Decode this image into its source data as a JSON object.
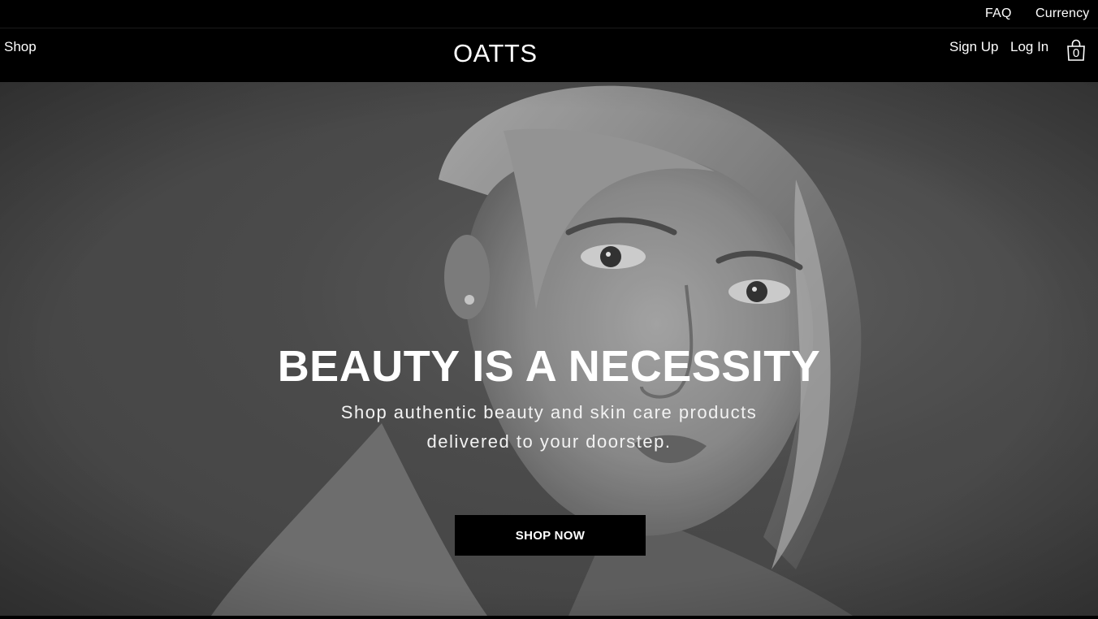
{
  "topbar": {
    "faq_label": "FAQ",
    "currency_label": "Currency"
  },
  "nav": {
    "shop_label": "Shop",
    "logo_text": "OATTS",
    "signup_label": "Sign Up",
    "login_label": "Log In",
    "cart_count": "0",
    "cart_icon": "shopping-bag-icon"
  },
  "hero": {
    "title": "BEAUTY IS A NECESSITY",
    "subtitle": "Shop authentic beauty and skin care products delivered to your doorstep.",
    "cta_label": "SHOP NOW"
  },
  "colors": {
    "background": "#000000",
    "hero_overlay": "#555555",
    "text": "#ffffff",
    "button": "#000000"
  }
}
